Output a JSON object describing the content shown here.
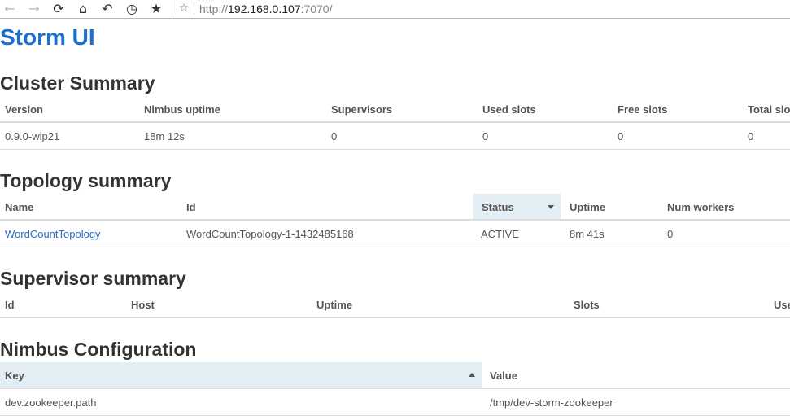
{
  "browser": {
    "url_scheme": "http://",
    "url_host": "192.168.0.107",
    "url_port": ":7070/"
  },
  "app_title": "Storm UI",
  "cluster_summary": {
    "title": "Cluster Summary",
    "columns": [
      "Version",
      "Nimbus uptime",
      "Supervisors",
      "Used slots",
      "Free slots",
      "Total slots"
    ],
    "rows": [
      [
        "0.9.0-wip21",
        "18m 12s",
        "0",
        "0",
        "0",
        "0"
      ]
    ]
  },
  "topology_summary": {
    "title": "Topology summary",
    "columns": [
      "Name",
      "Id",
      "Status",
      "Uptime",
      "Num workers"
    ],
    "sorted_column": "Status",
    "rows": [
      [
        "WordCountTopology",
        "WordCountTopology-1-1432485168",
        "ACTIVE",
        "8m 41s",
        "0"
      ]
    ]
  },
  "supervisor_summary": {
    "title": "Supervisor summary",
    "columns": [
      "Id",
      "Host",
      "Uptime",
      "Slots",
      "Used slots"
    ]
  },
  "nimbus_configuration": {
    "title": "Nimbus Configuration",
    "columns": [
      "Key",
      "Value"
    ],
    "sorted_column": "Key",
    "rows": [
      [
        "dev.zookeeper.path",
        "/tmp/dev-storm-zookeeper"
      ]
    ]
  },
  "colors": {
    "title_blue": "#1a6fcf",
    "link_blue": "#2a6cc1",
    "sorted_header_bg": "#e3eef4",
    "border": "#dddddd"
  }
}
